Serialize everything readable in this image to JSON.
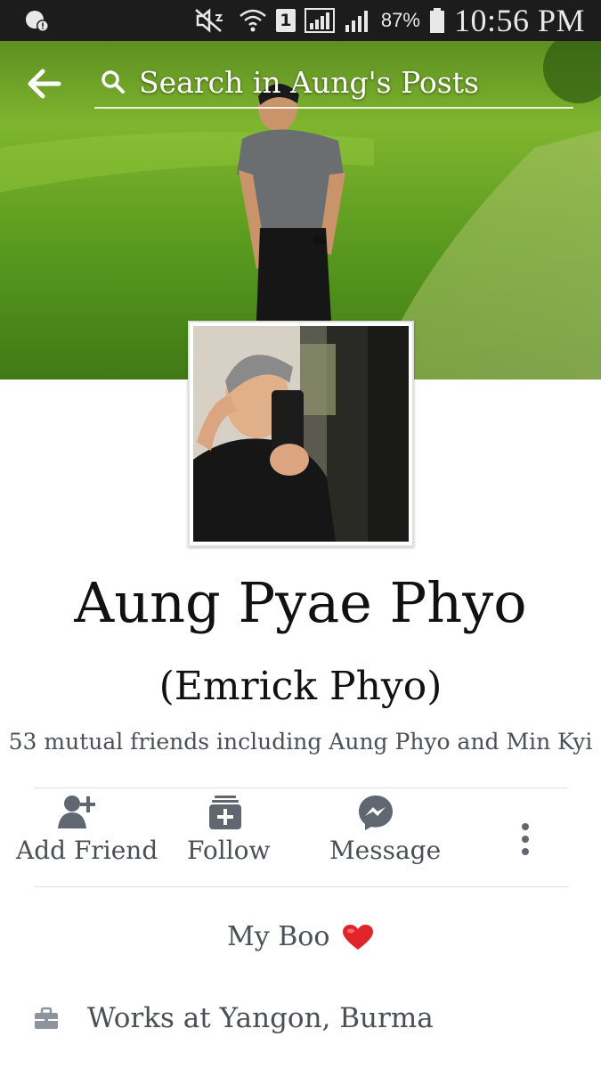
{
  "status_bar": {
    "battery_percent": "87%",
    "time": "10:56 PM",
    "sim_slot": "1",
    "icons": [
      "notification-icon",
      "mute-icon",
      "wifi-icon",
      "sim-icon",
      "signal-icon",
      "signal-icon-2",
      "battery-icon"
    ]
  },
  "header": {
    "search_placeholder": "Search in Aung's Posts",
    "back_icon": "arrow-left-icon",
    "search_icon": "search-icon"
  },
  "profile": {
    "name": "Aung Pyae Phyo",
    "alternate_name": "(Emrick Phyo)",
    "mutual_friends": "53 mutual friends including Aung Phyo and Min Kyi",
    "bio": "My Boo"
  },
  "actions": [
    {
      "label": "Add Friend",
      "icon": "add-friend-icon"
    },
    {
      "label": "Follow",
      "icon": "follow-icon"
    },
    {
      "label": "Message",
      "icon": "messenger-icon"
    }
  ],
  "about": {
    "work": "Works at Yangon, Burma",
    "work_icon": "briefcase-icon"
  },
  "colors": {
    "status_bar_bg": "#1c1c1c",
    "action_icon": "#606770",
    "text_secondary": "#4b4f56",
    "heart": "#e0242c"
  }
}
